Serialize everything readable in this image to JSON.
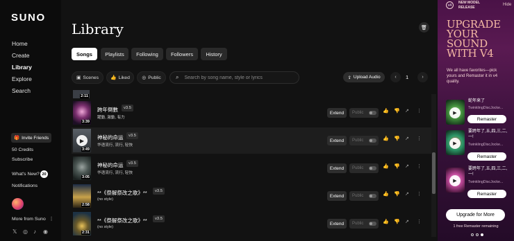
{
  "sidebar": {
    "logo": "SUNO",
    "nav": [
      "Home",
      "Create",
      "Library",
      "Explore",
      "Search"
    ],
    "invite_label": "Invite Friends",
    "credits": "50 Credits",
    "subscribe": "Subscribe",
    "whats_new": "What's New?",
    "whats_new_count": "20",
    "notifications": "Notifications",
    "more_from": "More from Suno"
  },
  "main": {
    "title": "Library",
    "tabs": [
      "Songs",
      "Playlists",
      "Following",
      "Followers",
      "History"
    ],
    "filters": {
      "scenes": "Scenes",
      "liked": "Liked",
      "public": "Public"
    },
    "search_placeholder": "Search by song name, style or lyrics",
    "upload_label": "Upload Audio",
    "page_number": "1",
    "top_duration": "2:11",
    "songs": [
      {
        "title": "跨年倒數",
        "version": "v3.5",
        "style": "躍動, 激動, 有力",
        "duration": "3:39"
      },
      {
        "title": "神秘的命运",
        "version": "v3.5",
        "style": "华语流行, 流行, 轻快",
        "duration": "3:49"
      },
      {
        "title": "神秘的命运",
        "version": "v3.5",
        "style": "华语流行, 流行, 轻快",
        "duration": "3:05"
      },
      {
        "title": "**《祭解祭改之歌》**",
        "version": "v3.5",
        "style": "(no style)",
        "duration": "2:58"
      },
      {
        "title": "**《祭解祭改之歌》**",
        "version": "v3.5",
        "style": "(no style)",
        "duration": "2:31"
      }
    ],
    "extend_label": "Extend",
    "public_label": "Public"
  },
  "panel": {
    "logo_text": "v4",
    "tag": "NEW MODEL RELEASE",
    "hide": "Hide",
    "headline": "UPGRADE YOUR SOUND WITH V4",
    "body": "We all have favorites—pick yours and Remaster it in v4 quality.",
    "promos": [
      {
        "title": "蛇年来了",
        "artist": "TwinklingDiscJocke..."
      },
      {
        "title": "要跨年了,五,四,三,二,一!",
        "artist": "TwinklingDiscJocke..."
      },
      {
        "title": "要跨年了,五,四,三,二,一!",
        "artist": "TwinklingDiscJocke..."
      }
    ],
    "remaster_label": "Remaster",
    "upgrade_label": "Upgrade for More",
    "remaining": "1 free Remaster remaining"
  }
}
